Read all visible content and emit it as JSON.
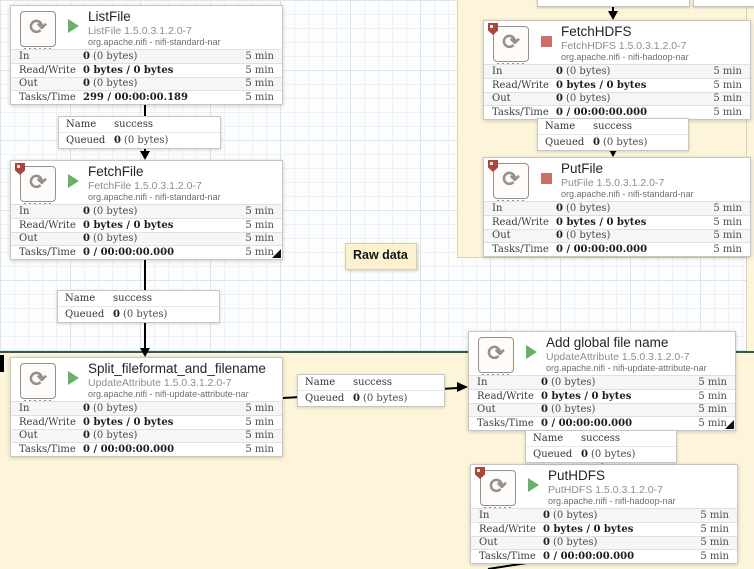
{
  "colors": {
    "label_fill": "#fdf5d9",
    "label_border_teal": "#2e5c54",
    "running_green": "#67b26b",
    "stopped_red": "#c9706b",
    "restricted_shield_red": "#ab4540"
  },
  "raw_label": {
    "text": "Raw data"
  },
  "processors": [
    {
      "id": "listfile",
      "title": "ListFile",
      "type": "ListFile 1.5.0.3.1.2.0-7",
      "bundle": "org.apache.nifi - nifi-standard-nar",
      "state": "running",
      "restricted": false,
      "corner_mark": false,
      "rows": [
        {
          "label": "In",
          "value": "0",
          "extra": "(0 bytes)",
          "window": "5 min"
        },
        {
          "label": "Read/Write",
          "value": "0 bytes / 0 bytes",
          "extra": "",
          "window": "5 min"
        },
        {
          "label": "Out",
          "value": "0",
          "extra": "(0 bytes)",
          "window": "5 min"
        },
        {
          "label": "Tasks/Time",
          "value": "299 / 00:00:00.189",
          "extra": "",
          "window": "5 min"
        }
      ]
    },
    {
      "id": "fetchhdfs",
      "title": "FetchHDFS",
      "type": "FetchHDFS 1.5.0.3.1.2.0-7",
      "bundle": "org.apache.nifi - nifi-hadoop-nar",
      "state": "stopped",
      "restricted": true,
      "corner_mark": false,
      "rows": [
        {
          "label": "In",
          "value": "0",
          "extra": "(0 bytes)",
          "window": "5 min"
        },
        {
          "label": "Read/Write",
          "value": "0 bytes / 0 bytes",
          "extra": "",
          "window": "5 min"
        },
        {
          "label": "Out",
          "value": "0",
          "extra": "(0 bytes)",
          "window": "5 min"
        },
        {
          "label": "Tasks/Time",
          "value": "0 / 00:00:00.000",
          "extra": "",
          "window": "5 min"
        }
      ]
    },
    {
      "id": "fetchfile",
      "title": "FetchFile",
      "type": "FetchFile 1.5.0.3.1.2.0-7",
      "bundle": "org.apache.nifi - nifi-standard-nar",
      "state": "running",
      "restricted": true,
      "corner_mark": true,
      "rows": [
        {
          "label": "In",
          "value": "0",
          "extra": "(0 bytes)",
          "window": "5 min"
        },
        {
          "label": "Read/Write",
          "value": "0 bytes / 0 bytes",
          "extra": "",
          "window": "5 min"
        },
        {
          "label": "Out",
          "value": "0",
          "extra": "(0 bytes)",
          "window": "5 min"
        },
        {
          "label": "Tasks/Time",
          "value": "0 / 00:00:00.000",
          "extra": "",
          "window": "5 min"
        }
      ]
    },
    {
      "id": "putfile",
      "title": "PutFile",
      "type": "PutFile 1.5.0.3.1.2.0-7",
      "bundle": "org.apache.nifi - nifi-standard-nar",
      "state": "stopped",
      "restricted": true,
      "corner_mark": false,
      "rows": [
        {
          "label": "In",
          "value": "0",
          "extra": "(0 bytes)",
          "window": "5 min"
        },
        {
          "label": "Read/Write",
          "value": "0 bytes / 0 bytes",
          "extra": "",
          "window": "5 min"
        },
        {
          "label": "Out",
          "value": "0",
          "extra": "(0 bytes)",
          "window": "5 min"
        },
        {
          "label": "Tasks/Time",
          "value": "0 / 00:00:00.000",
          "extra": "",
          "window": "5 min"
        }
      ]
    },
    {
      "id": "split",
      "title": "Split_fileformat_and_filename",
      "type": "UpdateAttribute 1.5.0.3.1.2.0-7",
      "bundle": "org.apache.nifi - nifi-update-attribute-nar",
      "state": "running",
      "restricted": false,
      "corner_mark": false,
      "rows": [
        {
          "label": "In",
          "value": "0",
          "extra": "(0 bytes)",
          "window": "5 min"
        },
        {
          "label": "Read/Write",
          "value": "0 bytes / 0 bytes",
          "extra": "",
          "window": "5 min"
        },
        {
          "label": "Out",
          "value": "0",
          "extra": "(0 bytes)",
          "window": "5 min"
        },
        {
          "label": "Tasks/Time",
          "value": "0 / 00:00:00.000",
          "extra": "",
          "window": "5 min"
        }
      ]
    },
    {
      "id": "addglobal",
      "title": "Add global file name",
      "type": "UpdateAttribute 1.5.0.3.1.2.0-7",
      "bundle": "org.apache.nifi - nifi-update-attribute-nar",
      "state": "running",
      "restricted": false,
      "corner_mark": true,
      "rows": [
        {
          "label": "In",
          "value": "0",
          "extra": "(0 bytes)",
          "window": "5 min"
        },
        {
          "label": "Read/Write",
          "value": "0 bytes / 0 bytes",
          "extra": "",
          "window": "5 min"
        },
        {
          "label": "Out",
          "value": "0",
          "extra": "(0 bytes)",
          "window": "5 min"
        },
        {
          "label": "Tasks/Time",
          "value": "0 / 00:00:00.000",
          "extra": "",
          "window": "5 min"
        }
      ]
    },
    {
      "id": "puthdfs",
      "title": "PutHDFS",
      "type": "PutHDFS 1.5.0.3.1.2.0-7",
      "bundle": "org.apache.nifi - nifi-hadoop-nar",
      "state": "running",
      "restricted": true,
      "corner_mark": false,
      "rows": [
        {
          "label": "In",
          "value": "0",
          "extra": "(0 bytes)",
          "window": "5 min"
        },
        {
          "label": "Read/Write",
          "value": "0 bytes / 0 bytes",
          "extra": "",
          "window": "5 min"
        },
        {
          "label": "Out",
          "value": "0",
          "extra": "(0 bytes)",
          "window": "5 min"
        },
        {
          "label": "Tasks/Time",
          "value": "0 / 00:00:00.000",
          "extra": "",
          "window": "5 min"
        }
      ]
    }
  ],
  "connections": [
    {
      "name_label": "Name",
      "name_value": "success",
      "queued_label": "Queued",
      "queued_value": "0",
      "queued_extra": "(0 bytes)"
    },
    {
      "name_label": "Name",
      "name_value": "success",
      "queued_label": "Queued",
      "queued_value": "0",
      "queued_extra": "(0 bytes)"
    },
    {
      "name_label": "Name",
      "name_value": "success",
      "queued_label": "Queued",
      "queued_value": "0",
      "queued_extra": "(0 bytes)"
    },
    {
      "name_label": "Name",
      "name_value": "success",
      "queued_label": "Queued",
      "queued_value": "0",
      "queued_extra": "(0 bytes)"
    },
    {
      "name_label": "Name",
      "name_value": "success",
      "queued_label": "Queued",
      "queued_value": "0",
      "queued_extra": "(0 bytes)"
    }
  ]
}
